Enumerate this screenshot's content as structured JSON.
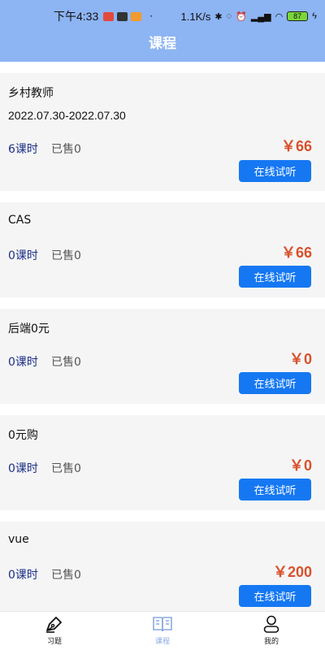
{
  "status_bar": {
    "time": "下午4:33",
    "dot": "·",
    "speed": "1.1K/s",
    "battery": "87"
  },
  "header": {
    "title": "课程"
  },
  "courses": [
    {
      "name": "乡村教师",
      "date": "2022.07.30-2022.07.30",
      "lessons": "6课时",
      "sold": "已售0",
      "price": "￥66",
      "button": "在线试听"
    },
    {
      "name": "CAS",
      "lessons": "0课时",
      "sold": "已售0",
      "price": "￥66",
      "button": "在线试听"
    },
    {
      "name": "后端0元",
      "lessons": "0课时",
      "sold": "已售0",
      "price": "￥0",
      "button": "在线试听"
    },
    {
      "name": "0元购",
      "lessons": "0课时",
      "sold": "已售0",
      "price": "￥0",
      "button": "在线试听"
    },
    {
      "name": "vue",
      "lessons": "0课时",
      "sold": "已售0",
      "price": "￥200",
      "button": "在线试听"
    }
  ],
  "tabs": [
    {
      "label": "习题",
      "icon": "pen-icon"
    },
    {
      "label": "课程",
      "icon": "book-icon",
      "active": true
    },
    {
      "label": "我的",
      "icon": "user-icon"
    }
  ],
  "colors": {
    "header_bg": "#8db4f3",
    "lesson_text": "#1c2f86",
    "price": "#d9512c",
    "button": "#1578f2",
    "active_tab": "#8aaae0"
  }
}
